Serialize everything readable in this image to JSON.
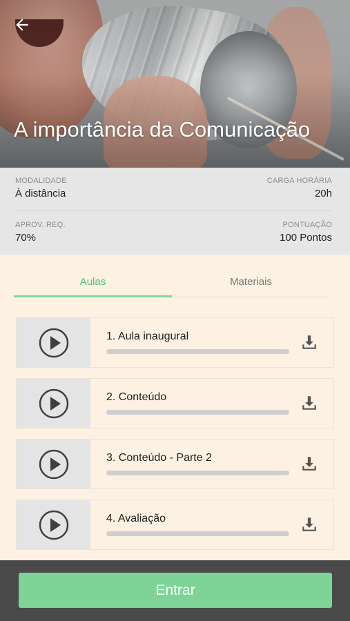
{
  "header": {
    "title": "A importância da Comunicação",
    "back_icon": "arrow-left-icon",
    "image_desc_icon": "hero-image"
  },
  "info": {
    "modalidade_label": "MODALIDADE",
    "modalidade_value": "À distância",
    "carga_label": "CARGA HORÁRIA",
    "carga_value": "20h",
    "aprov_label": "APROV. REQ.",
    "aprov_value": "70%",
    "pontuacao_label": "PONTUAÇÃO",
    "pontuacao_value": "100 Pontos"
  },
  "tabs": [
    {
      "label": "Aulas",
      "active": true
    },
    {
      "label": "Materiais",
      "active": false
    }
  ],
  "lessons": [
    {
      "title": "1. Aula inaugural",
      "progress": 0
    },
    {
      "title": "2. Conteúdo",
      "progress": 0
    },
    {
      "title": "3. Conteúdo - Parte 2",
      "progress": 0
    },
    {
      "title": "4. Avaliação",
      "progress": 0
    }
  ],
  "footer": {
    "enter_label": "Entrar"
  },
  "colors": {
    "accent": "#7ed496",
    "tab_active_text": "#4fbf78",
    "background": "#fdf1e3",
    "footer": "#4a4a4a"
  }
}
